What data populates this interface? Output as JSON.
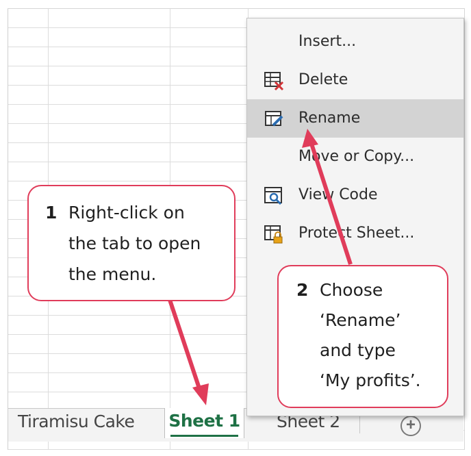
{
  "sheet_tabs": [
    {
      "label": "Tiramisu Cake",
      "active": false
    },
    {
      "label": "Sheet 1",
      "active": true
    },
    {
      "label": "Sheet 2",
      "active": false
    }
  ],
  "add_sheet_symbol": "+",
  "context_menu": {
    "items": [
      {
        "label": "Insert...",
        "icon": "none"
      },
      {
        "label": "Delete",
        "icon": "delete-sheet-icon"
      },
      {
        "label": "Rename",
        "icon": "rename-sheet-icon",
        "highlighted": true
      },
      {
        "label": "Move or Copy...",
        "icon": "none"
      },
      {
        "label": "View Code",
        "icon": "view-code-icon"
      },
      {
        "label": "Protect Sheet...",
        "icon": "protect-sheet-icon"
      }
    ],
    "submenu_chevron": "›"
  },
  "callouts": [
    {
      "number": "1",
      "lines": [
        "Right-click on",
        "the tab to open",
        "the menu."
      ]
    },
    {
      "number": "2",
      "lines": [
        "Choose",
        "‘Rename’",
        "and type",
        "‘My profits’."
      ]
    }
  ],
  "colors": {
    "accent_callout": "#e03c5a",
    "active_tab": "#1e7145",
    "menu_highlight": "#d3d3d3"
  }
}
